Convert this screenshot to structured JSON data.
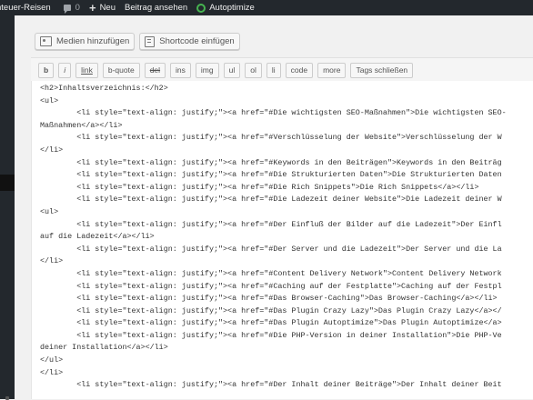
{
  "adminbar": {
    "site": "nteuer-Reisen",
    "comments_count": "0",
    "new_label": "Neu",
    "view_post": "Beitrag ansehen",
    "plugin": "Autoptimize"
  },
  "media": {
    "add_media": "Medien hinzufügen",
    "shortcode": "Shortcode einfügen"
  },
  "toolbar": {
    "buttons": [
      "b",
      "i",
      "link",
      "b-quote",
      "del",
      "ins",
      "img",
      "ul",
      "ol",
      "li",
      "code",
      "more",
      "Tags schließen"
    ]
  },
  "editor": {
    "lines": [
      "<h2>Inhaltsverzeichnis:</h2>",
      "<ul>",
      "        <li style=\"text-align: justify;\"><a href=\"#Die wichtigsten SEO-Maßnahmen\">Die wichtigsten SEO-",
      "Maßnahmen</a></li>",
      "        <li style=\"text-align: justify;\"><a href=\"#Verschlüsselung der Website\">Verschlüsselung der W",
      "</li>",
      "        <li style=\"text-align: justify;\"><a href=\"#Keywords in den Beiträgen\">Keywords in den Beiträg",
      "        <li style=\"text-align: justify;\"><a href=\"#Die Strukturierten Daten\">Die Strukturierten Daten",
      "        <li style=\"text-align: justify;\"><a href=\"#Die Rich Snippets\">Die Rich Snippets</a></li>",
      "        <li style=\"text-align: justify;\"><a href=\"#Die Ladezeit deiner Website\">Die Ladezeit deiner W",
      "<ul>",
      "        <li style=\"text-align: justify;\"><a href=\"#Der Einfluß der Bilder auf die Ladezeit\">Der Einfl",
      "auf die Ladezeit</a></li>",
      "        <li style=\"text-align: justify;\"><a href=\"#Der Server und die Ladezeit\">Der Server und die La",
      "</li>",
      "        <li style=\"text-align: justify;\"><a href=\"#Content Delivery Network\">Content Delivery Network",
      "        <li style=\"text-align: justify;\"><a href=\"#Caching auf der Festplatte\">Caching auf der Festpl",
      "        <li style=\"text-align: justify;\"><a href=\"#Das Browser-Caching\">Das Browser-Caching</a></li>",
      "        <li style=\"text-align: justify;\"><a href=\"#Das Plugin Crazy Lazy\">Das Plugin Crazy Lazy</a></",
      "        <li style=\"text-align: justify;\"><a href=\"#Das Plugin Autoptimize\">Das Plugin Autoptimize</a>",
      "        <li style=\"text-align: justify;\"><a href=\"#Die PHP-Version in deiner Installation\">Die PHP-Ve",
      "deiner Installation</a></li>",
      "</ul>",
      "</li>",
      "        <li style=\"text-align: justify;\"><a href=\"#Der Inhalt deiner Beiträge\">Der Inhalt deiner Beit"
    ]
  },
  "colors": {
    "adminbar_bg": "#23282d",
    "plugin_status": "#46b450",
    "editor_bg": "#ffffff"
  }
}
